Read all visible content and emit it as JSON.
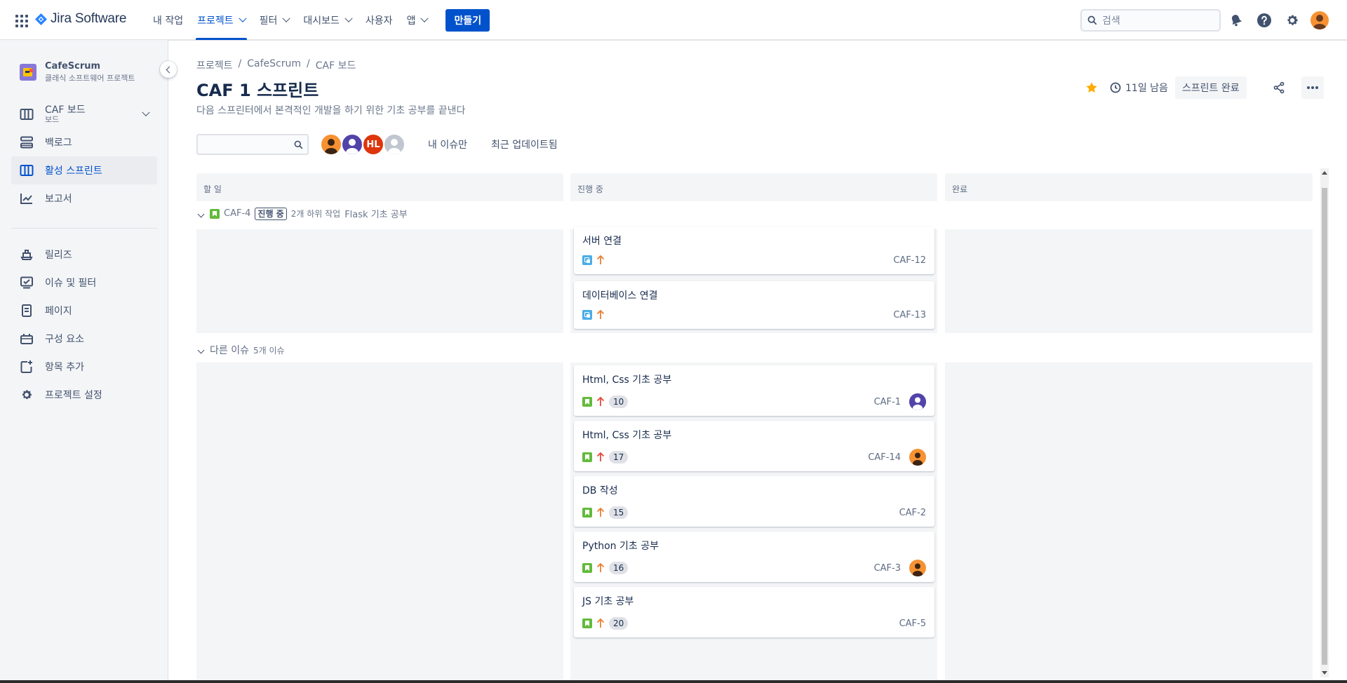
{
  "app": {
    "name": "Jira Software",
    "brand_color": "#0052cc"
  },
  "topnav": {
    "items": [
      {
        "label": "내 작업",
        "has_dropdown": false,
        "active": false
      },
      {
        "label": "프로젝트",
        "has_dropdown": true,
        "active": true
      },
      {
        "label": "필터",
        "has_dropdown": true,
        "active": false
      },
      {
        "label": "대시보드",
        "has_dropdown": true,
        "active": false
      },
      {
        "label": "사용자",
        "has_dropdown": false,
        "active": false
      },
      {
        "label": "앱",
        "has_dropdown": true,
        "active": false
      }
    ],
    "create_label": "만들기",
    "search_placeholder": "검색",
    "icons": [
      "notifications-icon",
      "help-icon",
      "settings-icon",
      "user-avatar"
    ]
  },
  "sidebar": {
    "project_name": "CafeScrum",
    "project_type": "클래식 소프트웨어 프로젝트",
    "items": [
      {
        "label": "CAF 보드",
        "sub": "보드",
        "icon": "board-icon",
        "active": false
      },
      {
        "label": "백로그",
        "icon": "backlog-icon",
        "active": false
      },
      {
        "label": "활성 스프린트",
        "icon": "active-sprint-icon",
        "active": true
      },
      {
        "label": "보고서",
        "icon": "reports-icon",
        "active": false
      },
      {
        "label": "릴리즈",
        "icon": "releases-icon",
        "active": false
      },
      {
        "label": "이슈 및 필터",
        "icon": "issues-icon",
        "active": false
      },
      {
        "label": "페이지",
        "icon": "pages-icon",
        "active": false
      },
      {
        "label": "구성 요소",
        "icon": "components-icon",
        "active": false
      },
      {
        "label": "항목 추가",
        "icon": "add-item-icon",
        "active": false
      },
      {
        "label": "프로젝트 설정",
        "icon": "project-settings-icon",
        "active": false
      }
    ]
  },
  "breadcrumb": [
    "프로젝트",
    "CafeScrum",
    "CAF 보드"
  ],
  "page": {
    "title": "CAF 1 스프린트",
    "goal": "다음 스프린터에서 본격적인 개발을 하기 위한 기초 공부를 끝낸다",
    "days_left": "11일 남음",
    "complete_sprint_label": "스프린트 완료"
  },
  "filters": {
    "quick_filters": [
      "내 이슈만",
      "최근 업데이트됨"
    ],
    "avatars": [
      {
        "type": "photo",
        "color": "#f79232"
      },
      {
        "type": "photo",
        "color": "#5243aa"
      },
      {
        "type": "initials",
        "text": "HL",
        "color": "#de350b"
      },
      {
        "type": "default",
        "color": "#c1c7d0"
      }
    ]
  },
  "columns": [
    "할 일",
    "진행 중",
    "완료"
  ],
  "swimlanes": [
    {
      "key": "CAF-4",
      "status": "진행 중",
      "subtask_count": "2개 하위 작업",
      "summary": "Flask 기초 공부",
      "cards": [
        {
          "title": "서버 연결",
          "type": "subtask",
          "priority": "medium",
          "key": "CAF-12",
          "column": 1
        },
        {
          "title": "데이터베이스 연결",
          "type": "subtask",
          "priority": "medium",
          "key": "CAF-13",
          "column": 1
        }
      ]
    },
    {
      "label": "다른 이슈",
      "count": "5개 이슈",
      "cards": [
        {
          "title": "Html, Css 기초 공부",
          "type": "story",
          "priority": "high",
          "points": "10",
          "key": "CAF-1",
          "assignee": "purple",
          "column": 1
        },
        {
          "title": "Html, Css 기초 공부",
          "type": "story",
          "priority": "high",
          "points": "17",
          "key": "CAF-14",
          "assignee": "orange",
          "column": 1
        },
        {
          "title": "DB 작성",
          "type": "story",
          "priority": "medium",
          "points": "15",
          "key": "CAF-2",
          "column": 1
        },
        {
          "title": "Python 기초 공부",
          "type": "story",
          "priority": "medium",
          "points": "16",
          "key": "CAF-3",
          "assignee": "orange",
          "column": 1
        },
        {
          "title": "JS 기초 공부",
          "type": "story",
          "priority": "medium",
          "points": "20",
          "key": "CAF-5",
          "column": 1
        }
      ]
    }
  ],
  "colors": {
    "priority_high": "#e5493a",
    "priority_medium": "#e97f33",
    "story": "#63ba3c",
    "subtask": "#4bade8",
    "star": "#ffab00"
  }
}
